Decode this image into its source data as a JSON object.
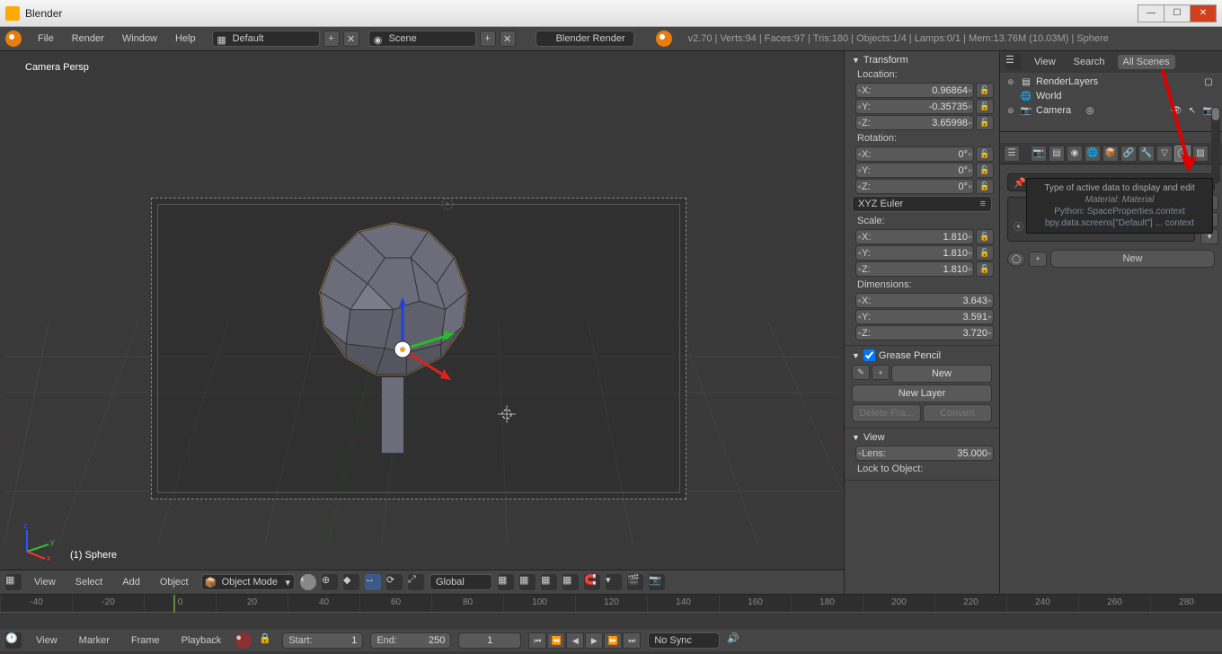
{
  "window": {
    "title": "Blender"
  },
  "top_menu": {
    "items": [
      "File",
      "Render",
      "Window",
      "Help"
    ]
  },
  "header": {
    "layout": "Default",
    "scene": "Scene",
    "engine": "Blender Render",
    "status": "v2.70 | Verts:94 | Faces:97 | Tris:180 | Objects:1/4 | Lamps:0/1 | Mem:13.76M (10.03M) | Sphere"
  },
  "viewport": {
    "persp_label": "Camera Persp",
    "object_name": "(1) Sphere",
    "footer_menu": [
      "View",
      "Select",
      "Add",
      "Object"
    ],
    "mode": "Object Mode",
    "orientation": "Global"
  },
  "n_panel": {
    "transform": {
      "title": "Transform",
      "location_label": "Location:",
      "location": {
        "x": "0.96864",
        "y": "-0.35735",
        "z": "3.65998"
      },
      "rotation_label": "Rotation:",
      "rotation": {
        "x": "0°",
        "y": "0°",
        "z": "0°"
      },
      "rotation_mode": "XYZ Euler",
      "scale_label": "Scale:",
      "scale": {
        "x": "1.810",
        "y": "1.810",
        "z": "1.810"
      },
      "dimensions_label": "Dimensions:",
      "dimensions": {
        "x": "3.643",
        "y": "3.591",
        "z": "3.720"
      }
    },
    "grease": {
      "title": "Grease Pencil",
      "new": "New",
      "new_layer": "New Layer",
      "delete_frame": "Delete Fra...",
      "convert": "Convert"
    },
    "view": {
      "title": "View",
      "lens_label": "Lens:",
      "lens": "35.000",
      "lock_label": "Lock to Object:"
    }
  },
  "outliner": {
    "tabs": {
      "view": "View",
      "search": "Search",
      "all_scenes": "All Scenes"
    },
    "items": [
      {
        "icon": "layers",
        "label": "RenderLayers"
      },
      {
        "icon": "world",
        "label": "World"
      },
      {
        "icon": "camera",
        "label": "Camera"
      }
    ]
  },
  "properties": {
    "new_btn": "New",
    "tooltip": {
      "title": "Type of active data to display and edit",
      "sub": "Material: Material",
      "py1": "Python: SpaceProperties.context",
      "py2": "bpy.data.screens[\"Default\"] ... context"
    }
  },
  "timeline": {
    "ticks": [
      "-40",
      "-20",
      "0",
      "20",
      "40",
      "60",
      "80",
      "100",
      "120",
      "140",
      "160",
      "180",
      "200",
      "220",
      "240",
      "260",
      "280"
    ],
    "menu": [
      "View",
      "Marker",
      "Frame",
      "Playback"
    ],
    "start_label": "Start:",
    "start": "1",
    "end_label": "End:",
    "end": "250",
    "current": "1",
    "sync": "No Sync"
  }
}
